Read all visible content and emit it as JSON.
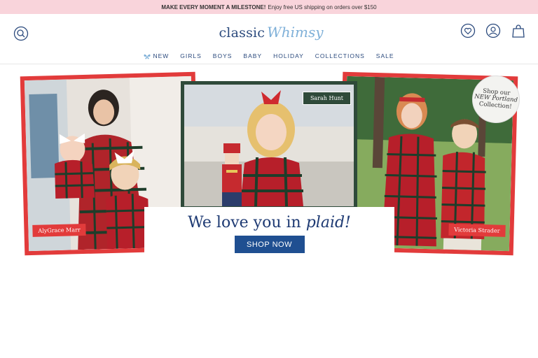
{
  "promo": {
    "bold": "MAKE EVERY MOMENT A MILESTONE!",
    "text": "Enjoy free US shipping on orders over $150"
  },
  "logo": {
    "part1": "classic",
    "part2": "Whimsy"
  },
  "nav": {
    "items": [
      "NEW",
      "GIRLS",
      "BOYS",
      "BABY",
      "HOLIDAY",
      "COLLECTIONS",
      "SALE"
    ]
  },
  "icons": {
    "search": "search-icon",
    "wishlist": "heart-icon",
    "account": "user-icon",
    "cart": "bag-icon",
    "new_marker": "butterfly-icon"
  },
  "hero": {
    "left_caption": "AlyGrace Marr",
    "center_caption": "Sarah Hunt",
    "right_caption": "Victoria Strader",
    "badge": {
      "line1": "Shop our",
      "line2": "NEW Portland",
      "line3": "Collection!"
    },
    "headline_start": "We love you in",
    "headline_emph": "plaid!",
    "cta": "SHOP NOW"
  },
  "colors": {
    "promo_bg": "#f9d4db",
    "brand_blue": "#2b4a7d",
    "accent_red": "#e23b3b",
    "cta_blue": "#1f4f91",
    "frame_green": "#2f4a3a"
  }
}
